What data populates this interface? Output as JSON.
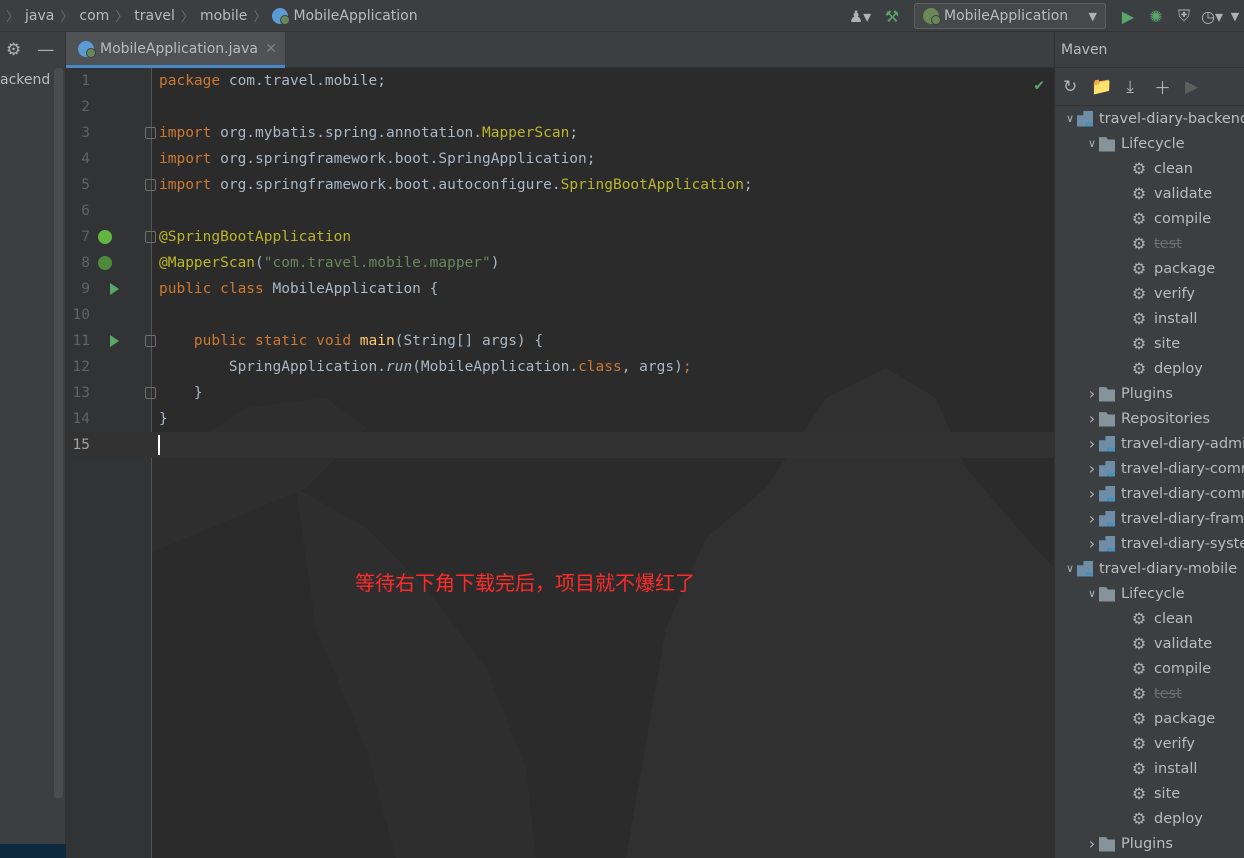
{
  "breadcrumb": {
    "items": [
      "java",
      "com",
      "travel",
      "mobile"
    ],
    "current": "MobileApplication"
  },
  "toolbar": {
    "run_config": "MobileApplication"
  },
  "left_panel": {
    "partial_label": "ackend"
  },
  "editor": {
    "tab_label": "MobileApplication.java",
    "note": "等待右下角下载完后，项目就不爆红了",
    "line_numbers": [
      "1",
      "2",
      "3",
      "4",
      "5",
      "6",
      "7",
      "8",
      "9",
      "10",
      "11",
      "12",
      "13",
      "14",
      "15"
    ],
    "code": {
      "l1_kw": "package",
      "l1_rest": " com.travel.mobile;",
      "l3_kw": "import",
      "l3_pkg": " org.mybatis.spring.annotation.",
      "l3_cls": "MapperScan",
      "l4_kw": "import",
      "l4_rest": " org.springframework.boot.SpringApplication;",
      "l5_kw": "import",
      "l5_pkg": " org.springframework.boot.autoconfigure.",
      "l5_cls": "SpringBootApplication",
      "l7": "@SpringBootApplication",
      "l8_ann": "@MapperScan",
      "l8_str": "\"com.travel.mobile.mapper\"",
      "l9_kw": "public class",
      "l9_rest": " MobileApplication {",
      "l11_kw": "    public static void",
      "l11_fn": "main",
      "l11_rest": "(String[] args) {",
      "l12_pre": "        SpringApplication.",
      "l12_fn": "run",
      "l12_mid": "(MobileApplication.",
      "l12_kw": "class",
      "l12_rest": ", args)",
      "l13": "    }",
      "l14": "}"
    }
  },
  "maven": {
    "title": "Maven",
    "tree": [
      {
        "label": "travel-diary-backend",
        "type": "module",
        "level": 0,
        "expanded": true
      },
      {
        "label": "Lifecycle",
        "type": "folder",
        "level": 1,
        "expanded": true
      },
      {
        "label": "clean",
        "type": "goal",
        "level": 2
      },
      {
        "label": "validate",
        "type": "goal",
        "level": 2
      },
      {
        "label": "compile",
        "type": "goal",
        "level": 2
      },
      {
        "label": "test",
        "type": "goal-disabled",
        "level": 2
      },
      {
        "label": "package",
        "type": "goal",
        "level": 2
      },
      {
        "label": "verify",
        "type": "goal",
        "level": 2
      },
      {
        "label": "install",
        "type": "goal",
        "level": 2
      },
      {
        "label": "site",
        "type": "goal",
        "level": 2
      },
      {
        "label": "deploy",
        "type": "goal",
        "level": 2
      },
      {
        "label": "Plugins",
        "type": "folder",
        "level": 1,
        "expanded": false
      },
      {
        "label": "Repositories",
        "type": "folder",
        "level": 1,
        "expanded": false
      },
      {
        "label": "travel-diary-admin",
        "type": "module",
        "level": 1,
        "expanded": false
      },
      {
        "label": "travel-diary-common",
        "type": "module",
        "level": 1,
        "expanded": false
      },
      {
        "label": "travel-diary-common",
        "type": "module",
        "level": 1,
        "expanded": false
      },
      {
        "label": "travel-diary-framework",
        "type": "module",
        "level": 1,
        "expanded": false
      },
      {
        "label": "travel-diary-system",
        "type": "module",
        "level": 1,
        "expanded": false
      },
      {
        "label": "travel-diary-mobile",
        "type": "module",
        "level": 0,
        "expanded": true
      },
      {
        "label": "Lifecycle",
        "type": "folder",
        "level": 1,
        "expanded": true
      },
      {
        "label": "clean",
        "type": "goal",
        "level": 2
      },
      {
        "label": "validate",
        "type": "goal",
        "level": 2
      },
      {
        "label": "compile",
        "type": "goal",
        "level": 2
      },
      {
        "label": "test",
        "type": "goal-disabled",
        "level": 2
      },
      {
        "label": "package",
        "type": "goal",
        "level": 2
      },
      {
        "label": "verify",
        "type": "goal",
        "level": 2
      },
      {
        "label": "install",
        "type": "goal",
        "level": 2
      },
      {
        "label": "site",
        "type": "goal",
        "level": 2
      },
      {
        "label": "deploy",
        "type": "goal",
        "level": 2
      },
      {
        "label": "Plugins",
        "type": "folder",
        "level": 1,
        "expanded": false
      }
    ]
  }
}
